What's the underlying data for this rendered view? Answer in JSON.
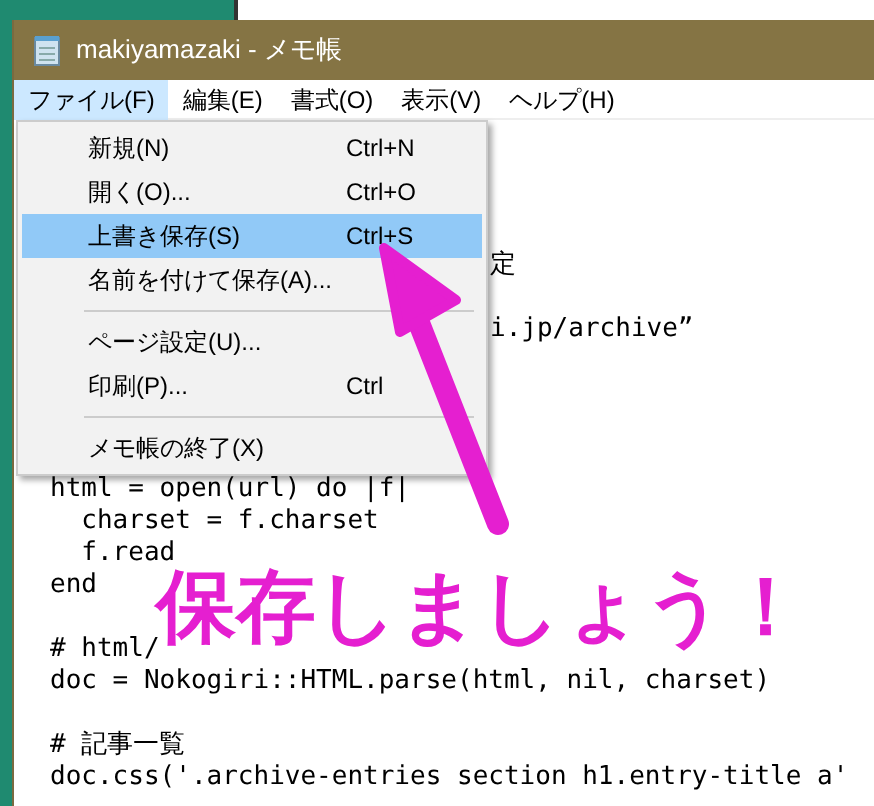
{
  "window": {
    "title": "makiyamazaki - メモ帳"
  },
  "menubar": [
    {
      "label": "ファイル(F)",
      "selected": true
    },
    {
      "label": "編集(E)",
      "selected": false
    },
    {
      "label": "書式(O)",
      "selected": false
    },
    {
      "label": "表示(V)",
      "selected": false
    },
    {
      "label": "ヘルプ(H)",
      "selected": false
    }
  ],
  "file_menu": {
    "items": [
      {
        "kind": "item",
        "label": "新規(N)",
        "shortcut": "Ctrl+N",
        "selected": false
      },
      {
        "kind": "item",
        "label": "開く(O)...",
        "shortcut": "Ctrl+O",
        "selected": false
      },
      {
        "kind": "item",
        "label": "上書き保存(S)",
        "shortcut": "Ctrl+S",
        "selected": true
      },
      {
        "kind": "item",
        "label": "名前を付けて保存(A)...",
        "selected": false
      },
      {
        "kind": "separator"
      },
      {
        "kind": "item",
        "label": "ページ設定(U)...",
        "selected": false
      },
      {
        "kind": "item",
        "label": "印刷(P)...",
        "shortcut": "Ctrl",
        "selected": false
      },
      {
        "kind": "separator"
      },
      {
        "kind": "item",
        "label": "メモ帳の終了(X)",
        "selected": false
      }
    ]
  },
  "editor": {
    "lines": [
      {
        "kind": "blank"
      },
      {
        "kind": "blank"
      },
      {
        "kind": "blank"
      },
      {
        "kind": "blank"
      },
      {
        "kind": "tail",
        "text": "定"
      },
      {
        "kind": "blank"
      },
      {
        "kind": "tail",
        "text": "i.jp/archive”"
      },
      {
        "kind": "blank"
      },
      {
        "kind": "blank"
      },
      {
        "kind": "blank"
      },
      {
        "kind": "blank"
      },
      {
        "kind": "code",
        "text": "html = open(url) do |f|"
      },
      {
        "kind": "code",
        "text": "  charset = f.charset"
      },
      {
        "kind": "code",
        "text": "  f.read"
      },
      {
        "kind": "code",
        "text": "end"
      },
      {
        "kind": "blank"
      },
      {
        "kind": "code",
        "text": "# html/"
      },
      {
        "kind": "code",
        "text": "doc = Nokogiri::HTML.parse(html, nil, charset)"
      },
      {
        "kind": "blank"
      },
      {
        "kind": "code",
        "text": "# 記事一覧"
      },
      {
        "kind": "code",
        "text": "doc.css('.archive-entries section h1.entry-title a'"
      }
    ]
  },
  "annotation": {
    "text": "保存しましょう！"
  }
}
